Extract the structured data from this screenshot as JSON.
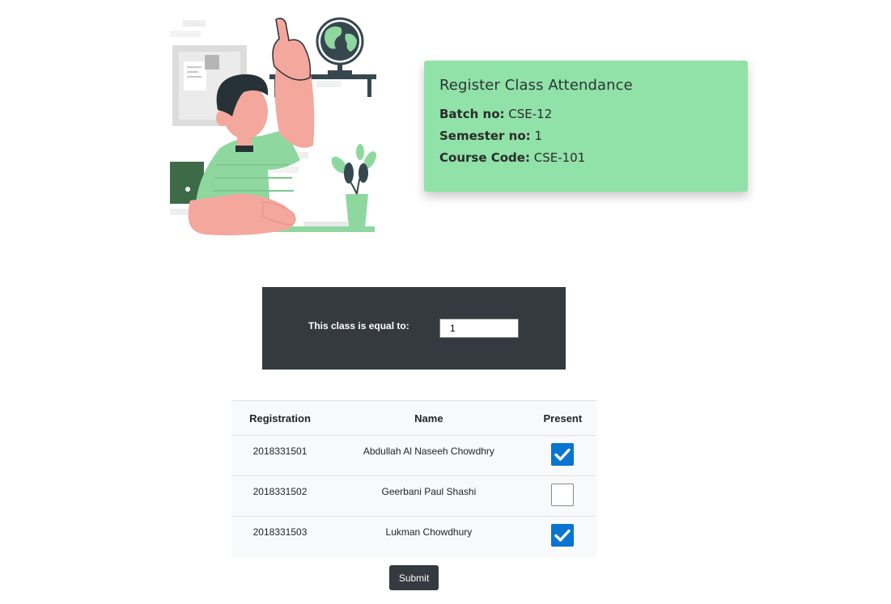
{
  "card": {
    "title": "Register Class Attendance",
    "batch_label": "Batch no:",
    "batch_value": "CSE-12",
    "semester_label": "Semester no:",
    "semester_value": "1",
    "course_label": "Course Code:",
    "course_value": "CSE-101",
    "background": "#90e2a8"
  },
  "class_equal": {
    "label": "This class is equal to:",
    "value": "1"
  },
  "table": {
    "headers": [
      "Registration",
      "Name",
      "Present"
    ],
    "rows": [
      {
        "registration": "2018331501",
        "name": "Abdullah Al Naseeh Chowdhry",
        "present": true
      },
      {
        "registration": "2018331502",
        "name": "Geerbani Paul Shashi",
        "present": false
      },
      {
        "registration": "2018331503",
        "name": "Lukman Chowdhury",
        "present": true
      }
    ]
  },
  "submit_label": "Submit",
  "colors": {
    "accent_check": "#0a74d1",
    "dark_panel": "#343a40"
  },
  "illustration_icon": "student-raising-hand-illustration"
}
